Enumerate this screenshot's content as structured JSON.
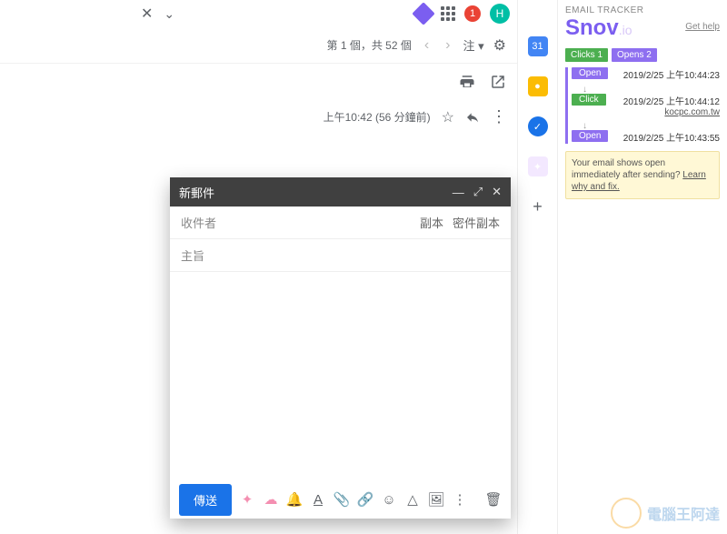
{
  "topbar": {
    "badge_count": "1",
    "avatar_letter": "H"
  },
  "nav": {
    "position": "第 1 個，共 52 個",
    "lang_btn": "注"
  },
  "mail": {
    "time_meta": "上午10:42 (56 分鐘前)"
  },
  "compose": {
    "title": "新郵件",
    "to_label": "收件者",
    "cc": "副本",
    "bcc": "密件副本",
    "subject_label": "主旨",
    "send": "傳送"
  },
  "tracker": {
    "title": "EMAIL TRACKER",
    "brand": "Snov",
    "brand_suffix": ".io",
    "help": "Get help",
    "clicks_label": "Clicks 1",
    "opens_label": "Opens 2",
    "events": [
      {
        "type": "Open",
        "color": "purple",
        "ts": "2019/2/25 上午10:44:23",
        "link": ""
      },
      {
        "type": "Click",
        "color": "green",
        "ts": "2019/2/25 上午10:44:12",
        "link": "kocpc.com.tw"
      },
      {
        "type": "Open",
        "color": "purple",
        "ts": "2019/2/25 上午10:43:55",
        "link": ""
      }
    ],
    "tip_text": "Your email shows open immediately after sending? ",
    "tip_link": "Learn why and fix."
  },
  "watermark": {
    "text": "電腦王阿達",
    "url": "http://www.kocpc.com.tw"
  }
}
